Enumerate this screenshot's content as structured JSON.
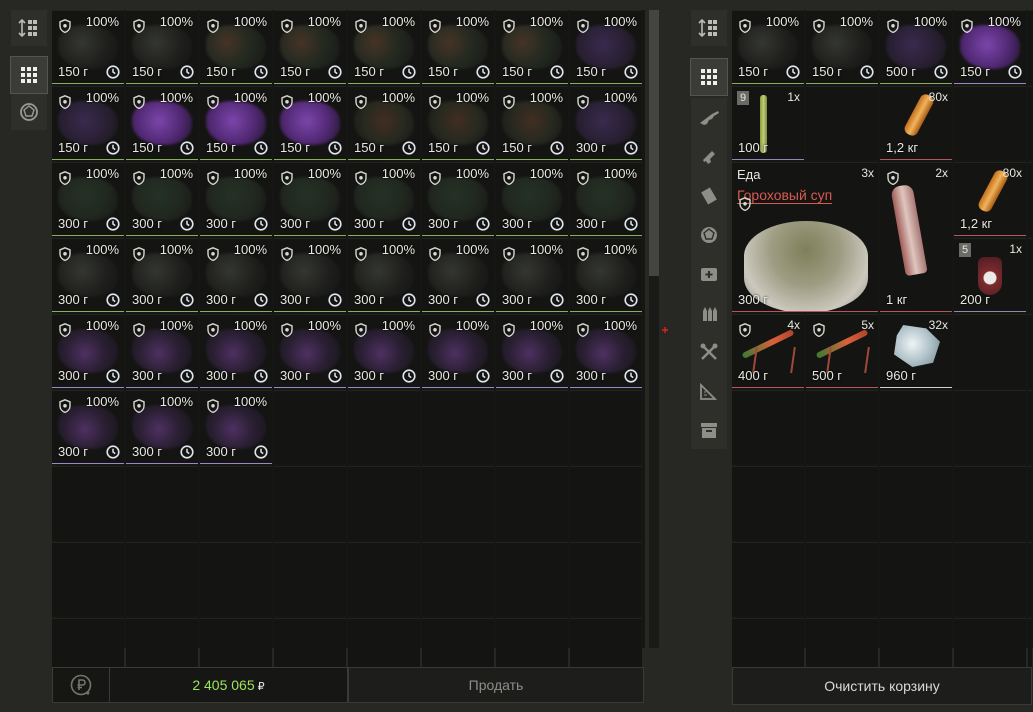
{
  "stash": {
    "items": [
      {
        "pct": "100%",
        "weight": "150 г",
        "thumb": "t-dark",
        "rarity": "green"
      },
      {
        "pct": "100%",
        "weight": "150 г",
        "thumb": "t-dark",
        "rarity": "green"
      },
      {
        "pct": "100%",
        "weight": "150 г",
        "thumb": "t-mix",
        "rarity": "green"
      },
      {
        "pct": "100%",
        "weight": "150 г",
        "thumb": "t-mix",
        "rarity": "green"
      },
      {
        "pct": "100%",
        "weight": "150 г",
        "thumb": "t-mix",
        "rarity": "green"
      },
      {
        "pct": "100%",
        "weight": "150 г",
        "thumb": "t-mix",
        "rarity": "green"
      },
      {
        "pct": "100%",
        "weight": "150 г",
        "thumb": "t-mix",
        "rarity": "green"
      },
      {
        "pct": "100%",
        "weight": "150 г",
        "thumb": "t-purple2",
        "rarity": "green"
      },
      {
        "pct": "100%",
        "weight": "150 г",
        "thumb": "t-purple2",
        "rarity": "green"
      },
      {
        "pct": "100%",
        "weight": "150 г",
        "thumb": "t-purple",
        "rarity": "green"
      },
      {
        "pct": "100%",
        "weight": "150 г",
        "thumb": "t-purple",
        "rarity": "green"
      },
      {
        "pct": "100%",
        "weight": "150 г",
        "thumb": "t-purple",
        "rarity": "green"
      },
      {
        "pct": "100%",
        "weight": "150 г",
        "thumb": "t-plant",
        "rarity": "green"
      },
      {
        "pct": "100%",
        "weight": "150 г",
        "thumb": "t-plant",
        "rarity": "green"
      },
      {
        "pct": "100%",
        "weight": "150 г",
        "thumb": "t-plant",
        "rarity": "green"
      },
      {
        "pct": "100%",
        "weight": "300 г",
        "thumb": "t-purple2",
        "rarity": "green"
      },
      {
        "pct": "100%",
        "weight": "300 г",
        "thumb": "t-moss",
        "rarity": "green"
      },
      {
        "pct": "100%",
        "weight": "300 г",
        "thumb": "t-moss",
        "rarity": "green"
      },
      {
        "pct": "100%",
        "weight": "300 г",
        "thumb": "t-moss",
        "rarity": "green"
      },
      {
        "pct": "100%",
        "weight": "300 г",
        "thumb": "t-moss",
        "rarity": "green"
      },
      {
        "pct": "100%",
        "weight": "300 г",
        "thumb": "t-moss",
        "rarity": "green"
      },
      {
        "pct": "100%",
        "weight": "300 г",
        "thumb": "t-moss",
        "rarity": "green"
      },
      {
        "pct": "100%",
        "weight": "300 г",
        "thumb": "t-moss",
        "rarity": "green"
      },
      {
        "pct": "100%",
        "weight": "300 г",
        "thumb": "t-moss",
        "rarity": "green"
      },
      {
        "pct": "100%",
        "weight": "300 г",
        "thumb": "t-dark",
        "rarity": "green"
      },
      {
        "pct": "100%",
        "weight": "300 г",
        "thumb": "t-dark",
        "rarity": "green"
      },
      {
        "pct": "100%",
        "weight": "300 г",
        "thumb": "t-dark",
        "rarity": "green"
      },
      {
        "pct": "100%",
        "weight": "300 г",
        "thumb": "t-dark",
        "rarity": "green"
      },
      {
        "pct": "100%",
        "weight": "300 г",
        "thumb": "t-dark",
        "rarity": "green"
      },
      {
        "pct": "100%",
        "weight": "300 г",
        "thumb": "t-dark",
        "rarity": "green"
      },
      {
        "pct": "100%",
        "weight": "300 г",
        "thumb": "t-dark",
        "rarity": "green"
      },
      {
        "pct": "100%",
        "weight": "300 г",
        "thumb": "t-dark",
        "rarity": "green"
      },
      {
        "pct": "100%",
        "weight": "300 г",
        "thumb": "t-crystal",
        "rarity": "purple"
      },
      {
        "pct": "100%",
        "weight": "300 г",
        "thumb": "t-crystal",
        "rarity": "purple"
      },
      {
        "pct": "100%",
        "weight": "300 г",
        "thumb": "t-crystal",
        "rarity": "purple"
      },
      {
        "pct": "100%",
        "weight": "300 г",
        "thumb": "t-crystal",
        "rarity": "purple"
      },
      {
        "pct": "100%",
        "weight": "300 г",
        "thumb": "t-crystal",
        "rarity": "purple"
      },
      {
        "pct": "100%",
        "weight": "300 г",
        "thumb": "t-crystal",
        "rarity": "purple"
      },
      {
        "pct": "100%",
        "weight": "300 г",
        "thumb": "t-crystal",
        "rarity": "purple"
      },
      {
        "pct": "100%",
        "weight": "300 г",
        "thumb": "t-crystal",
        "rarity": "purple"
      },
      {
        "pct": "100%",
        "weight": "300 г",
        "thumb": "t-crystal",
        "rarity": "purple"
      },
      {
        "pct": "100%",
        "weight": "300 г",
        "thumb": "t-crystal",
        "rarity": "purple"
      },
      {
        "pct": "100%",
        "weight": "300 г",
        "thumb": "t-crystal",
        "rarity": "purple"
      }
    ]
  },
  "cart": {
    "top_items": [
      {
        "pct": "100%",
        "weight": "150 г",
        "thumb": "t-dark",
        "rarity": "green"
      },
      {
        "pct": "100%",
        "weight": "150 г",
        "thumb": "t-dark",
        "rarity": "green"
      },
      {
        "pct": "100%",
        "weight": "500 г",
        "thumb": "t-purple2",
        "rarity": "green"
      },
      {
        "pct": "100%",
        "weight": "150 г",
        "thumb": "t-purple",
        "rarity": "purple"
      }
    ],
    "stick": {
      "badge": "9",
      "count": "1x",
      "weight": "100 г"
    },
    "shells1": {
      "count": "80x",
      "weight": "1,2 кг"
    },
    "soup": {
      "category": "Еда",
      "name": "Гороховый суп",
      "count": "3x",
      "weight": "300 г"
    },
    "bottle": {
      "count": "2x",
      "weight": "1 кг"
    },
    "shells2": {
      "count": "80x",
      "weight": "1,2 кг"
    },
    "dark_bottle": {
      "badge": "5",
      "count": "1x",
      "weight": "200 г"
    },
    "injector1": {
      "count": "4x",
      "weight": "400 г"
    },
    "injector2": {
      "count": "5x",
      "weight": "500 г"
    },
    "ice": {
      "count": "32x",
      "weight": "960 г"
    }
  },
  "footer": {
    "total": "2 405 065",
    "currency": "₽",
    "sell_label": "Продать",
    "clear_label": "Очистить корзину"
  },
  "colors": {
    "price_green": "#9ee35d",
    "rarity_green": "#88b05a",
    "rarity_purple": "#9c86c8",
    "soup_name_red": "#d65a52"
  },
  "left_toolbar": [
    "sort-icon",
    "grid-icon",
    "barter-icon"
  ],
  "right_toolbar": [
    "sort-icon",
    "grid-icon",
    "rifle-icon",
    "pistol-icon",
    "ammo-box-icon",
    "barter-icon",
    "medical-icon",
    "ammo-icon",
    "tools-icon",
    "ruler-icon",
    "container-icon"
  ]
}
